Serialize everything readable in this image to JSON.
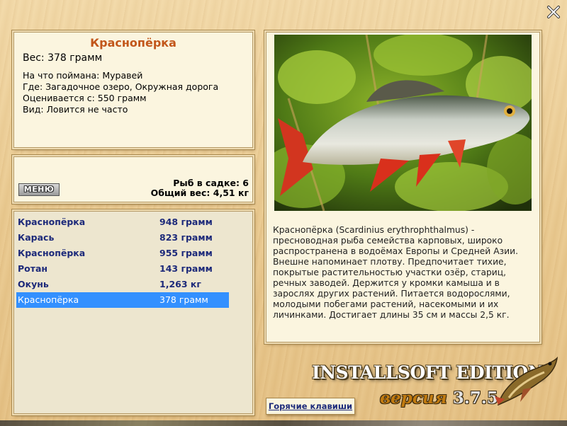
{
  "fish": {
    "name": "Краснопёрка",
    "weight_line": "Вес: 378 грамм",
    "details": [
      "На что поймана: Муравей",
      "Где: Загадочное озеро, Окружная дорога",
      "Оценивается с: 550 грамм",
      "Вид: Ловится не часто"
    ]
  },
  "cage": {
    "menu_label": "МЕНЮ",
    "count_line": "Рыб в садке: 6",
    "total_line": "Общий вес: 4,51 кг"
  },
  "catches": [
    {
      "name": "Краснопёрка",
      "weight": "948 грамм",
      "selected": false
    },
    {
      "name": "Карась",
      "weight": "823 грамм",
      "selected": false
    },
    {
      "name": "Краснопёрка",
      "weight": "955 грамм",
      "selected": false
    },
    {
      "name": "Ротан",
      "weight": "143 грамм",
      "selected": false
    },
    {
      "name": "Окунь",
      "weight": "1,263 кг",
      "selected": false
    },
    {
      "name": "Краснопёрка",
      "weight": "378 грамм",
      "selected": true
    }
  ],
  "description": "Краснопёрка (Scardinius erythrophthalmus) - пресноводная рыба семейства карповых, широко распространена в водоёмах Европы и Средней Азии. Внешне напоминает плотву. Предпочитает тихие, покрытые растительностью участки озёр, стариц, речных заводей. Держится у кромки камыша и в зарослях других растений. Питается водорослями, молодыми побегами растений, насекомыми и их личинками. Достигает длины 35 см и массы 2,5 кг.",
  "hotkeys_label": "Горячие клавиши",
  "branding": {
    "edition": "INSTALLSOFT EDITION",
    "version_word": "версия",
    "version_number": "3.7.5"
  },
  "icons": {
    "close": "close-icon",
    "logo": "pike-fish-logo"
  },
  "colors": {
    "title": "#c2561a",
    "list_text": "#1d2a7a",
    "selection": "#3390ff"
  }
}
